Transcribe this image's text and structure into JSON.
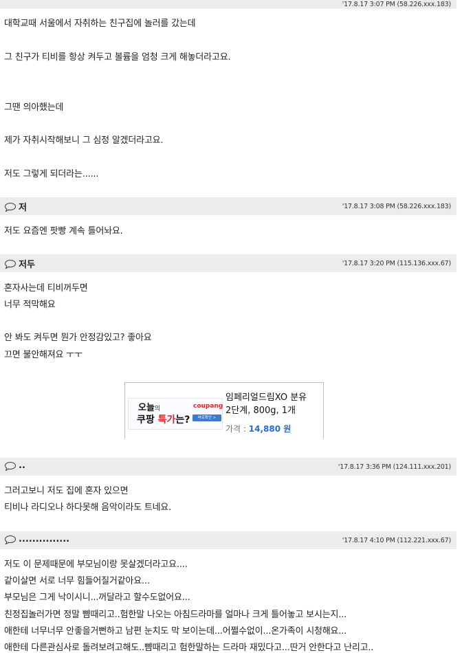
{
  "top_bar": {
    "meta": "'17.8.17 3:07 PM (58.226.xxx.183)"
  },
  "post0": {
    "lines": [
      "대학교때 서울에서 자취하는 친구집에 놀러를 갔는데",
      "그 친구가 티비를 항상 켜두고 볼륨을 엄청 크게 해놓더라고요.",
      "그땐 의아했는데",
      "제가 자취시작해보니 그 심정 알겠더라고요.",
      "저도 그렇게 되더라는......"
    ]
  },
  "comments": [
    {
      "author": "저",
      "meta": "'17.8.17 3:08 PM (58.226.xxx.183)",
      "lines": [
        "저도 요즘엔 팟빵 계속 틀어놔요."
      ]
    },
    {
      "author": "저두",
      "meta": "'17.8.17 3:20 PM (115.136.xxx.67)",
      "lines": [
        "혼자사는데 티비꺼두면",
        "너무 적막해요",
        "안 봐도 켜두면 뭔가 안정감있고? 좋아요",
        "끄면 불안해져요 ㅜㅜ"
      ]
    },
    {
      "author": "..",
      "meta": "'17.8.17 3:36 PM (124.111.xxx.201)",
      "lines": [
        "그러고보니 저도 집에 혼자 있으면",
        "티비나 라디오나 하다못해 음악이라도 트네요."
      ]
    },
    {
      "author": "...............",
      "meta": "'17.8.17 4:10 PM (112.221.xxx.67)",
      "lines": [
        "저도 이 문제때문에 부모님이랑 못살겠더라고요....",
        "같이살면 서로 너무 힘들어질거같아요...",
        "부모님은 그게 낙이시니...꺼달라고 할수도없어요...",
        "친정집놀러가면 정말 뺨때리고..험한말 나오는 아침드라마를 얼마나 크게 틀어놓고 보시는지...",
        "애한테 너무너무 안좋을거뻔하고 남편 눈치도 막 보이는데...어쩔수없이...온가족이 시청해요...",
        "애한테 다른관심사로 돌려보려고해도..뺨때리고 험한말하는 드라마 재밌다고...딴거 안한다고 난리고.."
      ]
    }
  ],
  "ad": {
    "banner_today": "오늘",
    "banner_today_suffix": "의",
    "banner_special_1": "쿠팡 ",
    "banner_special_red": "특가",
    "banner_special_2": "는?",
    "banner_brand": "coupang",
    "banner_button": "바로확인 >",
    "product_line1": "임페리얼드림XO 분유",
    "product_line2": "2단계, 800g, 1개",
    "price_label": "가격 : ",
    "price_value": "14,880 원"
  },
  "colors": {
    "bar_bg": "#ececec",
    "price_blue": "#2a6bd1",
    "brand_red": "#e4212b"
  }
}
